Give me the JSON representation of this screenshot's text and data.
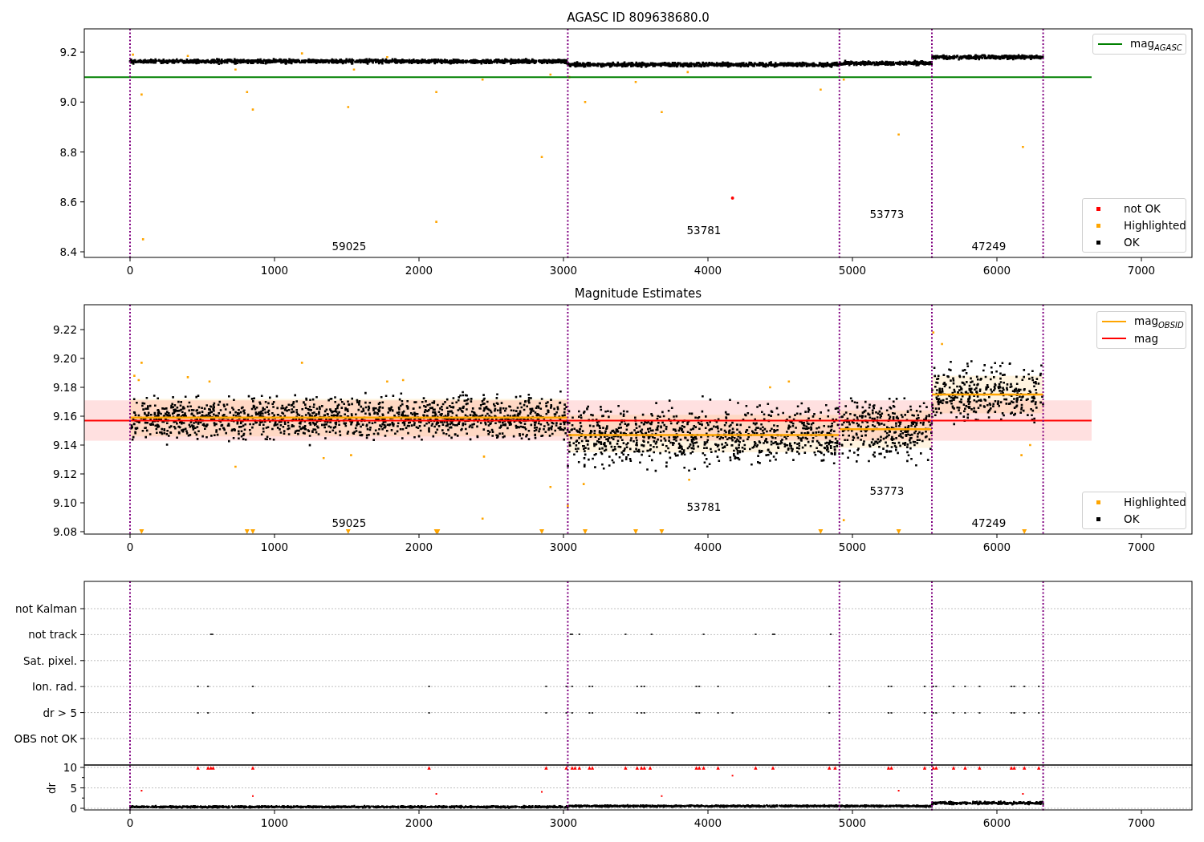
{
  "panels": [
    {
      "kind": "agasc",
      "title": "AGASC ID 809638680.0",
      "xticks": [
        "0",
        "1000",
        "2000",
        "3000",
        "4000",
        "5000",
        "6000",
        "7000"
      ],
      "yticks": [
        "9.2",
        "9.0",
        "8.8",
        "8.6",
        "8.4"
      ],
      "legends": [
        {
          "items": [
            {
              "kind": "line",
              "label": "mag$_{AGASC}$",
              "color": "#008000"
            }
          ]
        },
        {
          "items": [
            {
              "kind": "point",
              "label": "not OK",
              "color": "#ff0000"
            },
            {
              "kind": "point",
              "label": "Highlighted",
              "color": "#ffa500"
            },
            {
              "kind": "point",
              "label": "OK",
              "color": "#000000"
            }
          ]
        }
      ],
      "obsid_labels": [
        "59025",
        "53781",
        "53773",
        "47249"
      ]
    },
    {
      "kind": "estimates",
      "title": "Magnitude Estimates",
      "xticks": [
        "0",
        "1000",
        "2000",
        "3000",
        "4000",
        "5000",
        "6000",
        "7000"
      ],
      "yticks": [
        "9.22",
        "9.20",
        "9.18",
        "9.16",
        "9.14",
        "9.12",
        "9.10",
        "9.08"
      ],
      "legends": [
        {
          "items": [
            {
              "kind": "line",
              "label": "mag$_{OBSID}$",
              "color": "#ffa500"
            },
            {
              "kind": "line",
              "label": "mag",
              "color": "#ff0000"
            }
          ]
        },
        {
          "items": [
            {
              "kind": "point",
              "label": "Highlighted",
              "color": "#ffa500"
            },
            {
              "kind": "point",
              "label": "OK",
              "color": "#000000"
            }
          ]
        }
      ],
      "obsid_labels": [
        "59025",
        "53781",
        "53773",
        "47249"
      ]
    },
    {
      "kind": "flags",
      "xticks": [
        "0",
        "1000",
        "2000",
        "3000",
        "4000",
        "5000",
        "6000",
        "7000"
      ],
      "rows": [
        "not Kalman",
        "not track",
        "Sat. pixel.",
        "Ion. rad.",
        "dr > 5",
        "OBS not OK"
      ],
      "dr_yticks": [
        "10",
        "5",
        "0"
      ],
      "ylabel": "dr"
    }
  ]
}
